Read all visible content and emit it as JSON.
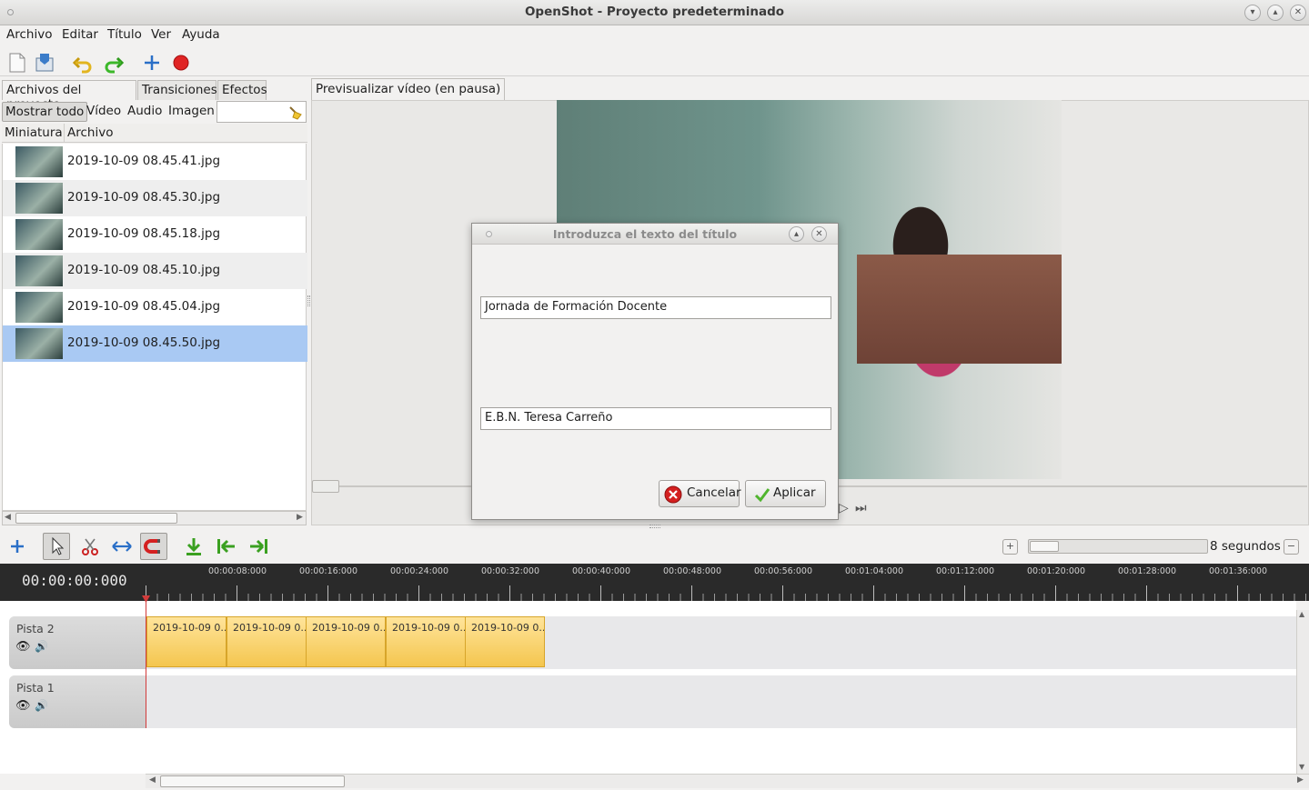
{
  "window": {
    "title": "OpenShot - Proyecto predeterminado"
  },
  "menu": [
    "Archivo",
    "Editar",
    "Título",
    "Ver",
    "Ayuda"
  ],
  "left_panel": {
    "tabs": [
      "Archivos del proyecto",
      "Transiciones",
      "Efectos"
    ],
    "filters": [
      "Mostrar todo",
      "Vídeo",
      "Audio",
      "Imagen"
    ],
    "columns": [
      "Miniatura",
      "Archivo"
    ],
    "files": [
      "2019-10-09 08.45.41.jpg",
      "2019-10-09 08.45.30.jpg",
      "2019-10-09 08.45.18.jpg",
      "2019-10-09 08.45.10.jpg",
      "2019-10-09 08.45.04.jpg",
      "2019-10-09 08.45.50.jpg"
    ],
    "selected_index": 5
  },
  "preview": {
    "tab": "Previsualizar vídeo (en pausa)"
  },
  "dialog": {
    "title": "Introduzca el texto del título",
    "line1": "Jornada de Formación Docente",
    "line2": "E.B.N. Teresa Carreño",
    "cancel": "Cancelar",
    "apply": "Aplicar"
  },
  "timeline": {
    "zoom_label": "8 segundos",
    "current_time": "00:00:00:000",
    "ticks": [
      "00:00:08:000",
      "00:00:16:000",
      "00:00:24:000",
      "00:00:32:000",
      "00:00:40:000",
      "00:00:48:000",
      "00:00:56:000",
      "00:01:04:000",
      "00:01:12:000",
      "00:01:20:000",
      "00:01:28:000",
      "00:01:36:000"
    ],
    "tracks": [
      {
        "name": "Pista 2",
        "clips": [
          "2019-10-09 0...",
          "2019-10-09 0...",
          "2019-10-09 0...",
          "2019-10-09 0...",
          "2019-10-09 0..."
        ]
      },
      {
        "name": "Pista 1",
        "clips": []
      }
    ]
  },
  "colors": {
    "selection": "#a9c9f3",
    "clip": "#f4c64f",
    "playhead": "#d23b3b",
    "ruler": "#2a2a2a"
  }
}
